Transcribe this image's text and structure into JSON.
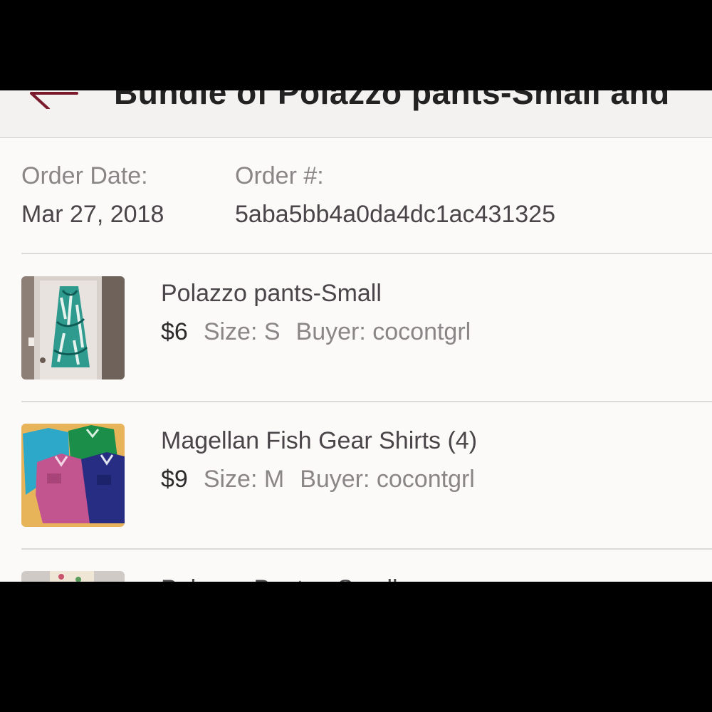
{
  "header": {
    "title": "Bundle of Polazzo pants-Small and",
    "back_icon": "back-arrow-icon",
    "accent_color": "#7b1a2c"
  },
  "order": {
    "date_label": "Order Date:",
    "date_value": "Mar 27, 2018",
    "number_label": "Order #:",
    "number_value": "5aba5bb4a0da4dc1ac431325"
  },
  "items": [
    {
      "title": "Polazzo pants-Small",
      "price": "$6",
      "size": "Size: S",
      "buyer": "Buyer: cocontgrl",
      "thumbnail": "palazzo-pants-photo"
    },
    {
      "title": "Magellan Fish Gear Shirts (4)",
      "price": "$9",
      "size": "Size: M",
      "buyer": "Buyer: cocontgrl",
      "thumbnail": "fishing-shirts-photo"
    },
    {
      "title": "Polazzo Pants - Small",
      "thumbnail": "floral-pants-photo"
    }
  ]
}
